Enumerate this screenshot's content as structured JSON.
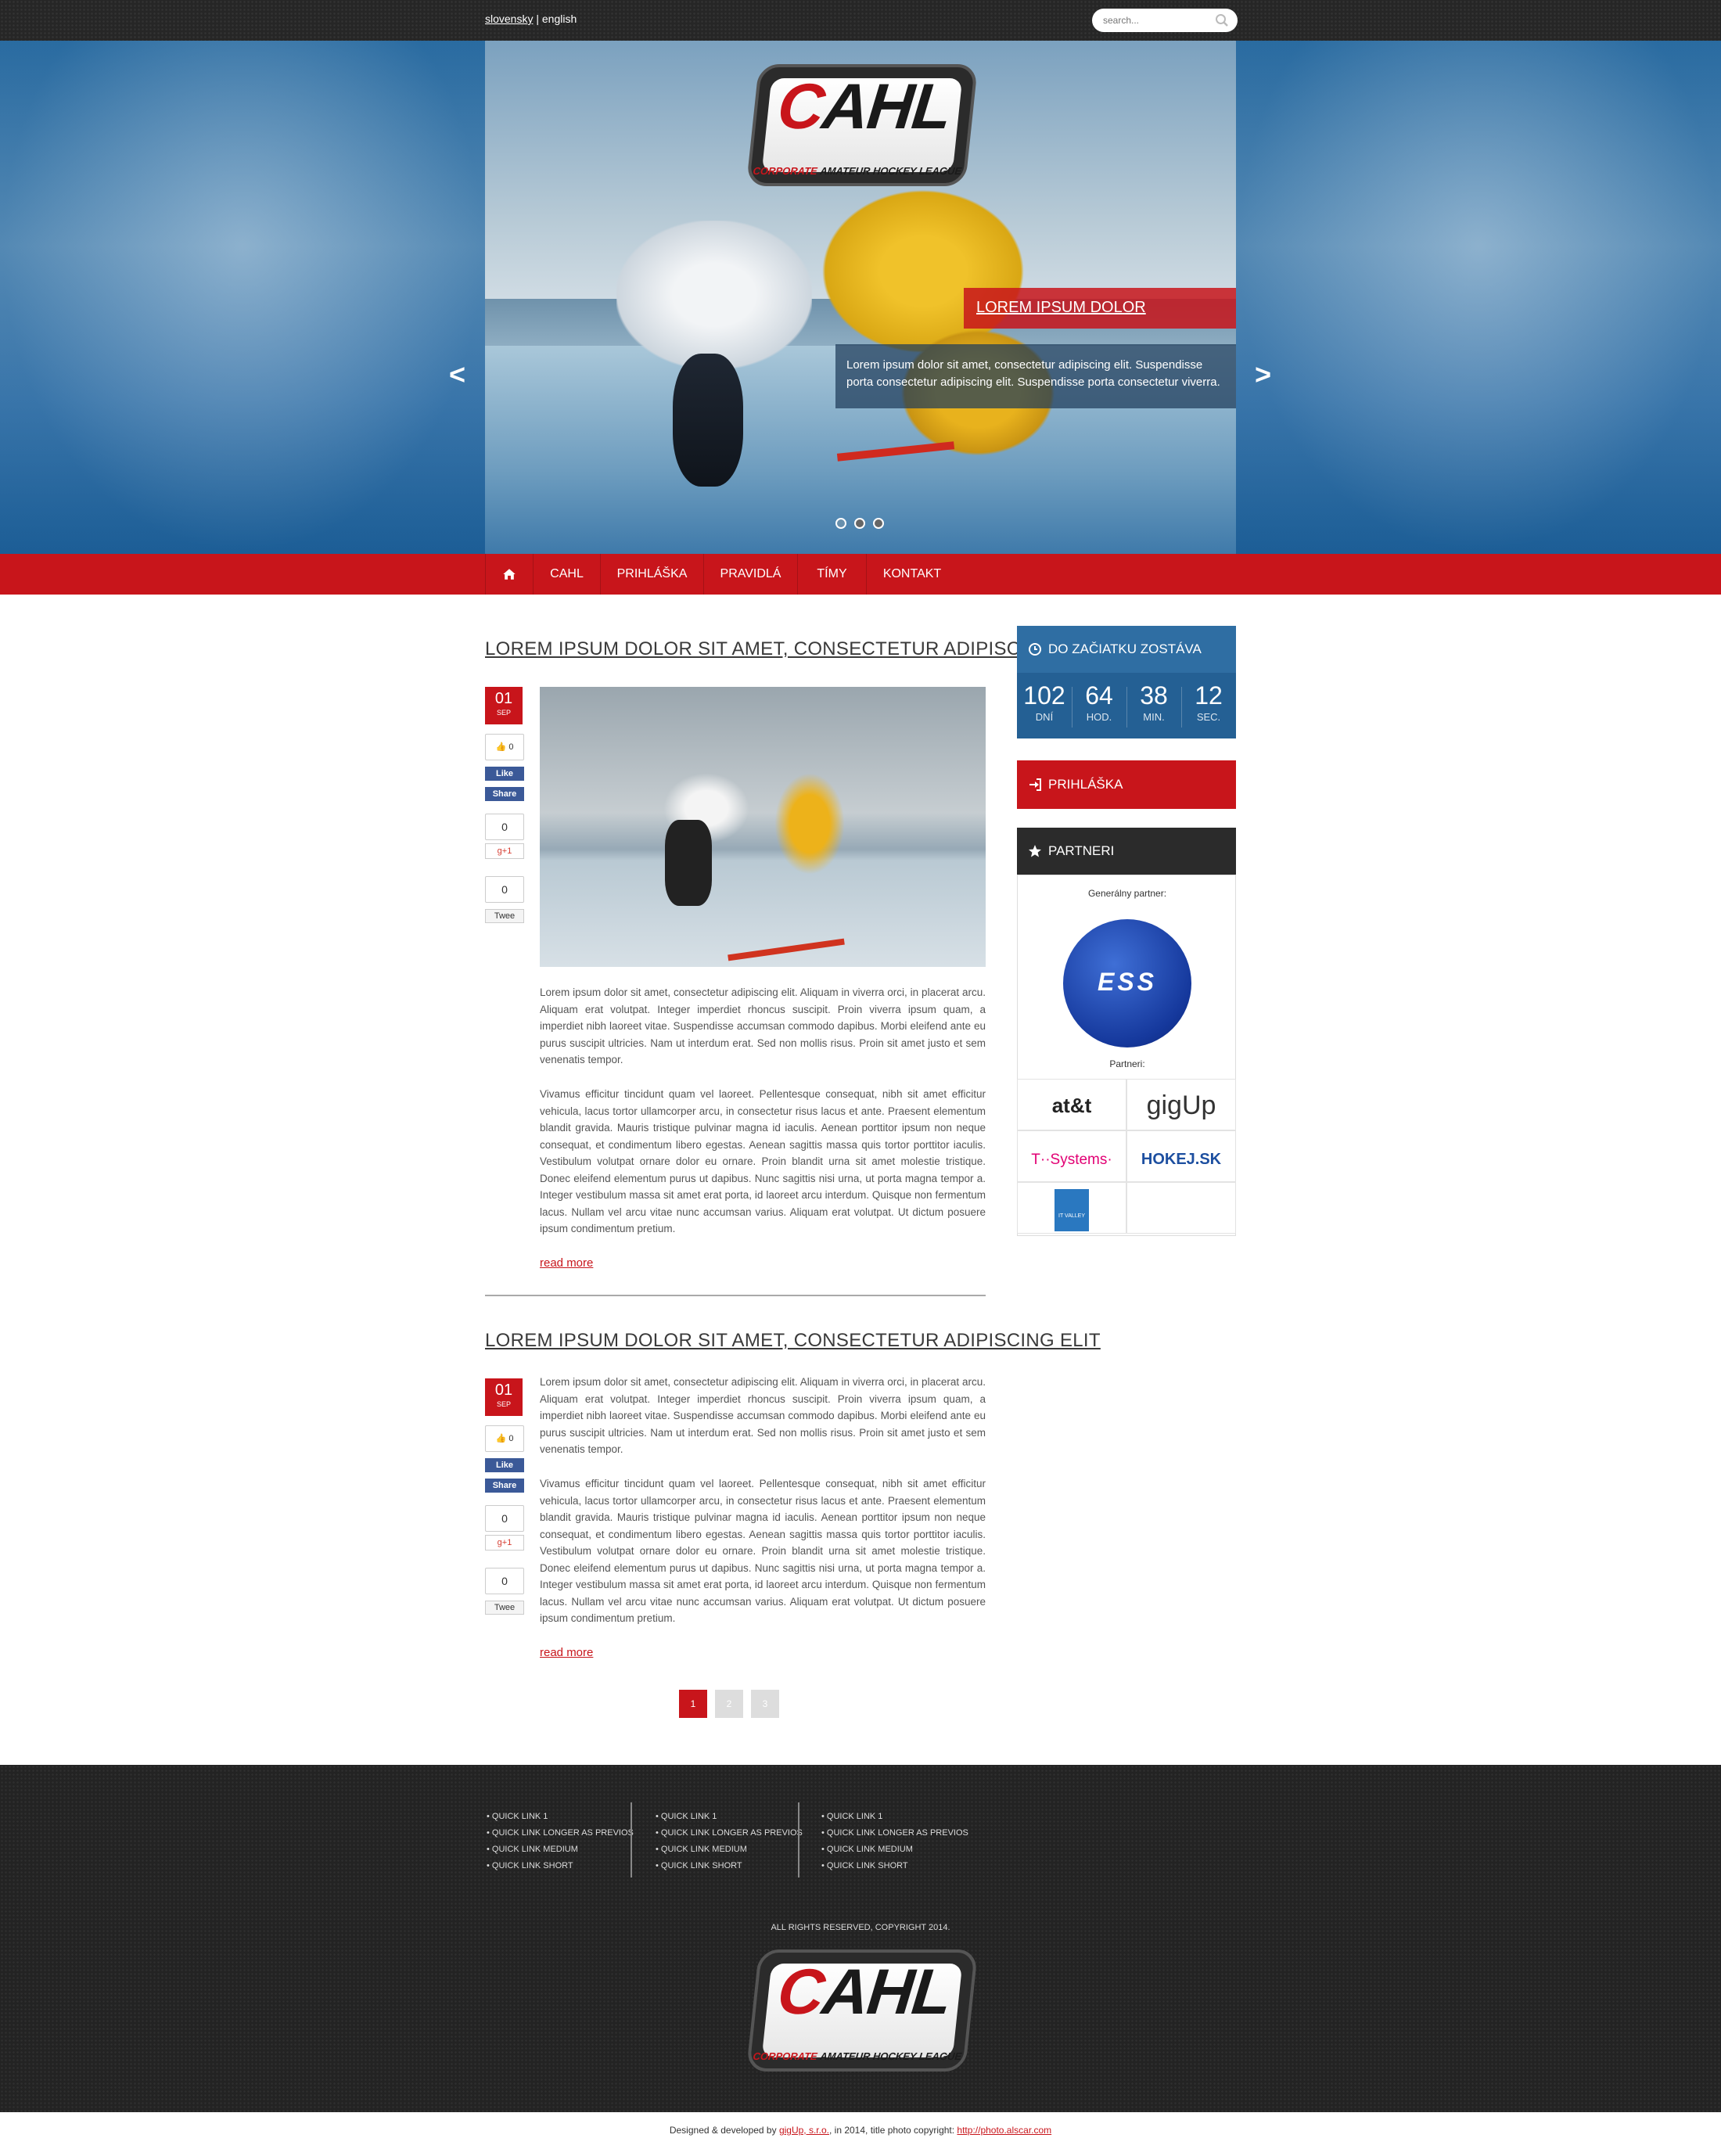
{
  "top": {
    "lang_sk": "slovensky",
    "lang_sep": "|",
    "lang_en": "english",
    "search_placeholder": "search..."
  },
  "brand": {
    "logo_main_a": "C",
    "logo_main_b": "AHL",
    "logo_sub_a": "CORPORATE",
    "logo_sub_b": "AMATEUR HOCKEY LEAGUE"
  },
  "slider": {
    "caption_title": "LOREM IPSUM DOLOR",
    "caption_text": "Lorem ipsum dolor sit amet, consectetur adipiscing elit. Suspendisse porta consectetur adipiscing elit. Suspendisse porta consectetur viverra.",
    "prev": "<",
    "next": ">",
    "slides": 3,
    "active_slide": 1
  },
  "nav": {
    "items": [
      "CAHL",
      "PRIHLÁŠKA",
      "PRAVIDLÁ",
      "TÍMY",
      "KONTAKT"
    ]
  },
  "posts": [
    {
      "title": "LOREM IPSUM DOLOR SIT AMET, CONSECTETUR ADIPISCING ELIT",
      "day": "01",
      "month": "SEP",
      "likes": "0",
      "fb_like": "Like",
      "fb_share": "Share",
      "gplus_count": "0",
      "gplus": "g+1",
      "tweet_count": "0",
      "tweet": "Twee",
      "p1": "Lorem ipsum dolor sit amet, consectetur adipiscing elit. Aliquam in viverra orci, in placerat arcu. Aliquam erat volutpat. Integer imperdiet rhoncus suscipit. Proin viverra ipsum quam, a imperdiet nibh laoreet vitae. Suspendisse accumsan commodo dapibus. Morbi eleifend ante eu purus suscipit ultricies. Nam ut interdum erat. Sed non mollis risus. Proin sit amet justo et sem venenatis tempor.",
      "p2": "Vivamus efficitur tincidunt quam vel laoreet. Pellentesque consequat, nibh sit amet efficitur vehicula, lacus tortor ullamcorper arcu, in consectetur risus lacus et ante. Praesent elementum blandit gravida. Mauris tristique pulvinar magna id iaculis. Aenean porttitor ipsum non neque consequat, et condimentum libero egestas. Aenean sagittis massa quis tortor porttitor iaculis. Vestibulum volutpat ornare dolor eu ornare. Proin blandit urna sit amet molestie tristique. Donec eleifend elementum purus ut dapibus. Nunc sagittis nisi urna, ut porta magna tempor a. Integer vestibulum massa sit amet erat porta, id laoreet arcu interdum. Quisque non fermentum lacus. Nullam vel arcu vitae nunc accumsan varius. Aliquam erat volutpat. Ut dictum posuere ipsum condimentum pretium.",
      "read_more": "read more"
    },
    {
      "title": "LOREM IPSUM DOLOR SIT AMET, CONSECTETUR ADIPISCING ELIT",
      "day": "01",
      "month": "SEP",
      "likes": "0",
      "fb_like": "Like",
      "fb_share": "Share",
      "gplus_count": "0",
      "gplus": "g+1",
      "tweet_count": "0",
      "tweet": "Twee",
      "p1": "Lorem ipsum dolor sit amet, consectetur adipiscing elit. Aliquam in viverra orci, in placerat arcu. Aliquam erat volutpat. Integer imperdiet rhoncus suscipit. Proin viverra ipsum quam, a imperdiet nibh laoreet vitae. Suspendisse accumsan commodo dapibus. Morbi eleifend ante eu purus suscipit ultricies. Nam ut interdum erat. Sed non mollis risus. Proin sit amet justo et sem venenatis tempor.",
      "p2": "Vivamus efficitur tincidunt quam vel laoreet. Pellentesque consequat, nibh sit amet efficitur vehicula, lacus tortor ullamcorper arcu, in consectetur risus lacus et ante. Praesent elementum blandit gravida. Mauris tristique pulvinar magna id iaculis. Aenean porttitor ipsum non neque consequat, et condimentum libero egestas. Aenean sagittis massa quis tortor porttitor iaculis. Vestibulum volutpat ornare dolor eu ornare. Proin blandit urna sit amet molestie tristique. Donec eleifend elementum purus ut dapibus. Nunc sagittis nisi urna, ut porta magna tempor a. Integer vestibulum massa sit amet erat porta, id laoreet arcu interdum. Quisque non fermentum lacus. Nullam vel arcu vitae nunc accumsan varius. Aliquam erat volutpat. Ut dictum posuere ipsum condimentum pretium.",
      "read_more": "read more"
    }
  ],
  "pagination": [
    "1",
    "2",
    "3"
  ],
  "sidebar": {
    "countdown_title": "DO ZAČIATKU ZOSTÁVA",
    "countdown": [
      {
        "value": "102",
        "label": "DNÍ"
      },
      {
        "value": "64",
        "label": "HOD."
      },
      {
        "value": "38",
        "label": "MIN."
      },
      {
        "value": "12",
        "label": "SEC."
      }
    ],
    "signup": "PRIHLÁŠKA",
    "partners_title": "PARTNERI",
    "general_partner_label": "Generálny partner:",
    "general_partner": "ESS",
    "partners_label": "Partneri:",
    "partners": [
      "at&t",
      "gigUp",
      "T··Systems·",
      "HOKEJ.SK",
      "IT VALLEY"
    ]
  },
  "footer": {
    "columns": [
      [
        "• QUICK LINK 1",
        "• QUICK LINK LONGER AS PREVIOS",
        "• QUICK LINK MEDIUM",
        "• QUICK LINK SHORT"
      ],
      [
        "• QUICK LINK 1",
        "• QUICK LINK LONGER AS PREVIOS",
        "• QUICK LINK MEDIUM",
        "• QUICK LINK SHORT"
      ],
      [
        "• QUICK LINK 1",
        "• QUICK LINK LONGER AS PREVIOS",
        "• QUICK LINK MEDIUM",
        "• QUICK LINK SHORT"
      ]
    ],
    "copyright": "ALL RIGHTS RESERVED, COPYRIGHT 2014.",
    "credits_a": "Designed & developed by ",
    "credits_b": "gigUp, s.r.o.",
    "credits_c": ", in 2014, title photo copyright: ",
    "credits_d": "http://photo.alscar.com"
  },
  "colors": {
    "accent": "#c8151b",
    "blue": "#246094",
    "dark": "#2b2b2b"
  }
}
